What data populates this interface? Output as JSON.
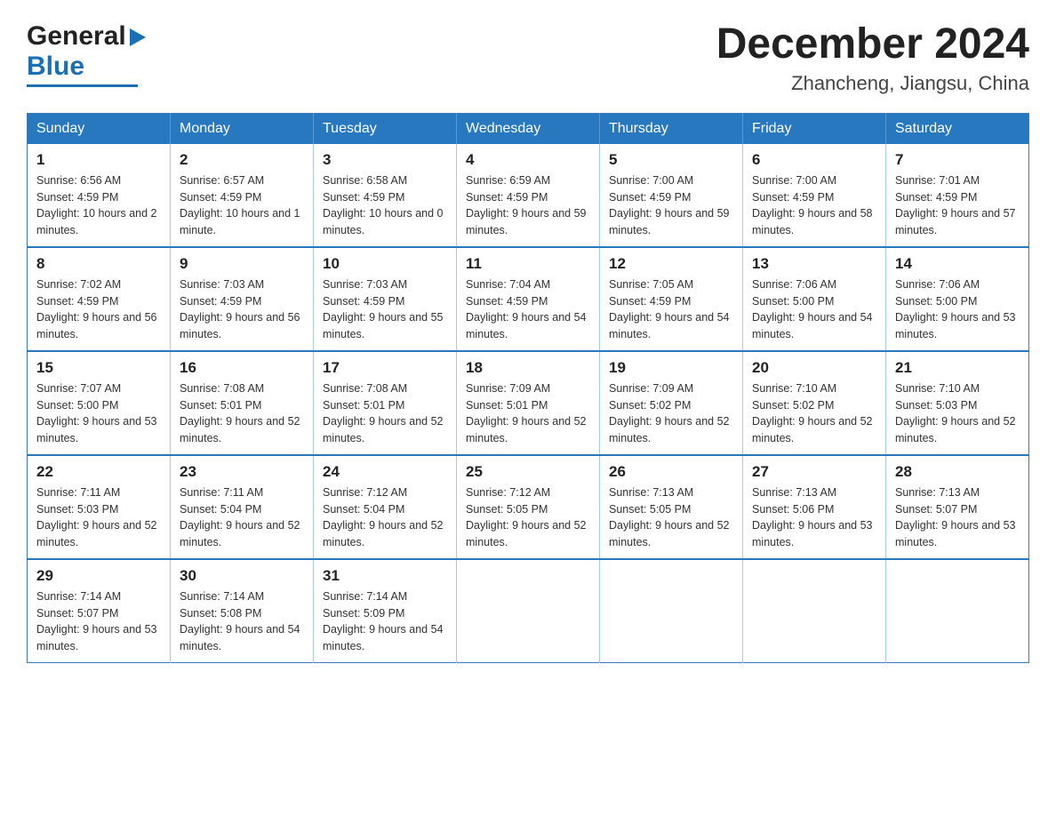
{
  "logo": {
    "general": "General",
    "blue": "Blue"
  },
  "title": {
    "month_year": "December 2024",
    "location": "Zhancheng, Jiangsu, China"
  },
  "weekdays": [
    "Sunday",
    "Monday",
    "Tuesday",
    "Wednesday",
    "Thursday",
    "Friday",
    "Saturday"
  ],
  "weeks": [
    [
      {
        "day": "1",
        "sunrise": "Sunrise: 6:56 AM",
        "sunset": "Sunset: 4:59 PM",
        "daylight": "Daylight: 10 hours and 2 minutes."
      },
      {
        "day": "2",
        "sunrise": "Sunrise: 6:57 AM",
        "sunset": "Sunset: 4:59 PM",
        "daylight": "Daylight: 10 hours and 1 minute."
      },
      {
        "day": "3",
        "sunrise": "Sunrise: 6:58 AM",
        "sunset": "Sunset: 4:59 PM",
        "daylight": "Daylight: 10 hours and 0 minutes."
      },
      {
        "day": "4",
        "sunrise": "Sunrise: 6:59 AM",
        "sunset": "Sunset: 4:59 PM",
        "daylight": "Daylight: 9 hours and 59 minutes."
      },
      {
        "day": "5",
        "sunrise": "Sunrise: 7:00 AM",
        "sunset": "Sunset: 4:59 PM",
        "daylight": "Daylight: 9 hours and 59 minutes."
      },
      {
        "day": "6",
        "sunrise": "Sunrise: 7:00 AM",
        "sunset": "Sunset: 4:59 PM",
        "daylight": "Daylight: 9 hours and 58 minutes."
      },
      {
        "day": "7",
        "sunrise": "Sunrise: 7:01 AM",
        "sunset": "Sunset: 4:59 PM",
        "daylight": "Daylight: 9 hours and 57 minutes."
      }
    ],
    [
      {
        "day": "8",
        "sunrise": "Sunrise: 7:02 AM",
        "sunset": "Sunset: 4:59 PM",
        "daylight": "Daylight: 9 hours and 56 minutes."
      },
      {
        "day": "9",
        "sunrise": "Sunrise: 7:03 AM",
        "sunset": "Sunset: 4:59 PM",
        "daylight": "Daylight: 9 hours and 56 minutes."
      },
      {
        "day": "10",
        "sunrise": "Sunrise: 7:03 AM",
        "sunset": "Sunset: 4:59 PM",
        "daylight": "Daylight: 9 hours and 55 minutes."
      },
      {
        "day": "11",
        "sunrise": "Sunrise: 7:04 AM",
        "sunset": "Sunset: 4:59 PM",
        "daylight": "Daylight: 9 hours and 54 minutes."
      },
      {
        "day": "12",
        "sunrise": "Sunrise: 7:05 AM",
        "sunset": "Sunset: 4:59 PM",
        "daylight": "Daylight: 9 hours and 54 minutes."
      },
      {
        "day": "13",
        "sunrise": "Sunrise: 7:06 AM",
        "sunset": "Sunset: 5:00 PM",
        "daylight": "Daylight: 9 hours and 54 minutes."
      },
      {
        "day": "14",
        "sunrise": "Sunrise: 7:06 AM",
        "sunset": "Sunset: 5:00 PM",
        "daylight": "Daylight: 9 hours and 53 minutes."
      }
    ],
    [
      {
        "day": "15",
        "sunrise": "Sunrise: 7:07 AM",
        "sunset": "Sunset: 5:00 PM",
        "daylight": "Daylight: 9 hours and 53 minutes."
      },
      {
        "day": "16",
        "sunrise": "Sunrise: 7:08 AM",
        "sunset": "Sunset: 5:01 PM",
        "daylight": "Daylight: 9 hours and 52 minutes."
      },
      {
        "day": "17",
        "sunrise": "Sunrise: 7:08 AM",
        "sunset": "Sunset: 5:01 PM",
        "daylight": "Daylight: 9 hours and 52 minutes."
      },
      {
        "day": "18",
        "sunrise": "Sunrise: 7:09 AM",
        "sunset": "Sunset: 5:01 PM",
        "daylight": "Daylight: 9 hours and 52 minutes."
      },
      {
        "day": "19",
        "sunrise": "Sunrise: 7:09 AM",
        "sunset": "Sunset: 5:02 PM",
        "daylight": "Daylight: 9 hours and 52 minutes."
      },
      {
        "day": "20",
        "sunrise": "Sunrise: 7:10 AM",
        "sunset": "Sunset: 5:02 PM",
        "daylight": "Daylight: 9 hours and 52 minutes."
      },
      {
        "day": "21",
        "sunrise": "Sunrise: 7:10 AM",
        "sunset": "Sunset: 5:03 PM",
        "daylight": "Daylight: 9 hours and 52 minutes."
      }
    ],
    [
      {
        "day": "22",
        "sunrise": "Sunrise: 7:11 AM",
        "sunset": "Sunset: 5:03 PM",
        "daylight": "Daylight: 9 hours and 52 minutes."
      },
      {
        "day": "23",
        "sunrise": "Sunrise: 7:11 AM",
        "sunset": "Sunset: 5:04 PM",
        "daylight": "Daylight: 9 hours and 52 minutes."
      },
      {
        "day": "24",
        "sunrise": "Sunrise: 7:12 AM",
        "sunset": "Sunset: 5:04 PM",
        "daylight": "Daylight: 9 hours and 52 minutes."
      },
      {
        "day": "25",
        "sunrise": "Sunrise: 7:12 AM",
        "sunset": "Sunset: 5:05 PM",
        "daylight": "Daylight: 9 hours and 52 minutes."
      },
      {
        "day": "26",
        "sunrise": "Sunrise: 7:13 AM",
        "sunset": "Sunset: 5:05 PM",
        "daylight": "Daylight: 9 hours and 52 minutes."
      },
      {
        "day": "27",
        "sunrise": "Sunrise: 7:13 AM",
        "sunset": "Sunset: 5:06 PM",
        "daylight": "Daylight: 9 hours and 53 minutes."
      },
      {
        "day": "28",
        "sunrise": "Sunrise: 7:13 AM",
        "sunset": "Sunset: 5:07 PM",
        "daylight": "Daylight: 9 hours and 53 minutes."
      }
    ],
    [
      {
        "day": "29",
        "sunrise": "Sunrise: 7:14 AM",
        "sunset": "Sunset: 5:07 PM",
        "daylight": "Daylight: 9 hours and 53 minutes."
      },
      {
        "day": "30",
        "sunrise": "Sunrise: 7:14 AM",
        "sunset": "Sunset: 5:08 PM",
        "daylight": "Daylight: 9 hours and 54 minutes."
      },
      {
        "day": "31",
        "sunrise": "Sunrise: 7:14 AM",
        "sunset": "Sunset: 5:09 PM",
        "daylight": "Daylight: 9 hours and 54 minutes."
      },
      null,
      null,
      null,
      null
    ]
  ]
}
